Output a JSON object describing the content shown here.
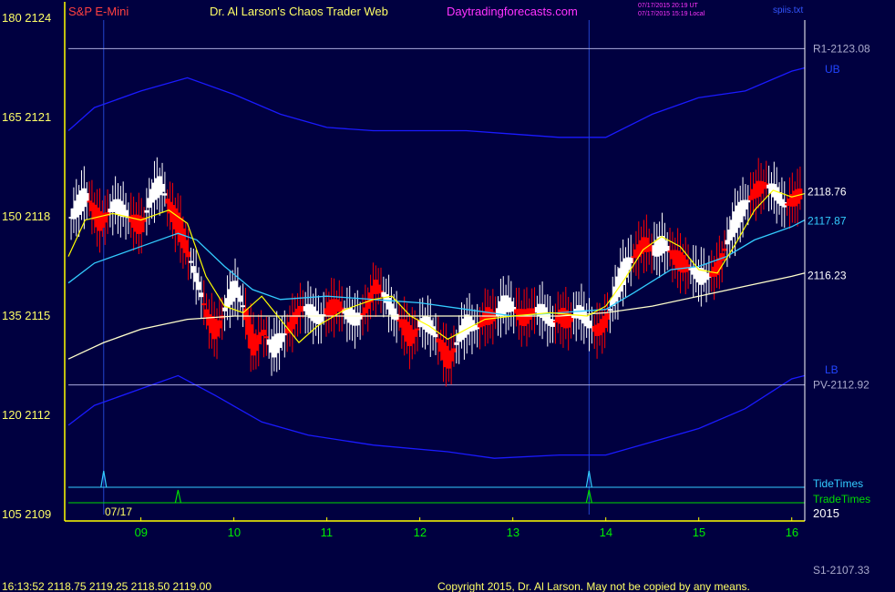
{
  "header": {
    "instrument": "S&P E-Mini",
    "site_title": "Dr. Al Larson's Chaos Trader Web",
    "site_url": "Daytradingforecasts.com",
    "timestamp_ut": "07/17/2015 20:19 UT",
    "timestamp_local": "07/17/2015 15:19 Local",
    "file": "spiis.txt"
  },
  "footer": {
    "quote_line": "16:13:52  2118.75  2119.25  2118.50  2119.00",
    "copyright": "Copyright 2015, Dr. Al Larson. May not be copied by any means.",
    "s1_label": "S1-2107.33"
  },
  "colors": {
    "background": "#000040",
    "axis": "#ffff00",
    "frame": "#ffff00",
    "up_bar": "#ffffff",
    "down_bar": "#ff0000",
    "band": "#1a1aff",
    "ema_fast": "#ffff00",
    "ema_mid": "#33ccff",
    "ema_slow": "#ffffcc",
    "tide": "#33ccff",
    "trade": "#00dd00",
    "instrument": "#ff4040",
    "site_title": "#ffff66",
    "site_url": "#ff33ff"
  },
  "chart_data": {
    "type": "candlestick",
    "y_ticks": [
      {
        "left": "180",
        "price": "2124",
        "value": 2124
      },
      {
        "left": "165",
        "price": "2121",
        "value": 2121
      },
      {
        "left": "150",
        "price": "2118",
        "value": 2118
      },
      {
        "left": "135",
        "price": "2115",
        "value": 2115
      },
      {
        "left": "120",
        "price": "2112",
        "value": 2112
      },
      {
        "left": "105",
        "price": "2109",
        "value": 2109
      }
    ],
    "ylim": [
      2109,
      2124
    ],
    "x_ticks": [
      "09",
      "10",
      "11",
      "12",
      "13",
      "14",
      "15",
      "16"
    ],
    "xlim": [
      8.22,
      16.14
    ],
    "date_label": "07/17",
    "year_label": "2015",
    "levels": [
      {
        "label": "R1-2123.08",
        "value": 2123.08
      },
      {
        "label": "PV-2112.92",
        "value": 2112.92
      }
    ],
    "band_labels": {
      "upper": "UB",
      "lower": "LB"
    },
    "ma_labels": [
      {
        "label": "2118.76",
        "value": 2118.76
      },
      {
        "label": "2117.87",
        "value": 2117.87
      },
      {
        "label": "2116.23",
        "value": 2116.23
      }
    ],
    "tide_label": "TideTimes",
    "trade_label": "TradeTimes",
    "tide_times": [
      8.6,
      13.82
    ],
    "trade_times": [
      9.4,
      13.82
    ],
    "vertical_markers": [
      8.6,
      13.82
    ],
    "upper_band": [
      [
        8.22,
        2120.6
      ],
      [
        8.5,
        2121.3
      ],
      [
        9.0,
        2121.8
      ],
      [
        9.5,
        2122.2
      ],
      [
        10.0,
        2121.7
      ],
      [
        10.5,
        2121.1
      ],
      [
        11.0,
        2120.7
      ],
      [
        11.5,
        2120.6
      ],
      [
        12.0,
        2120.6
      ],
      [
        12.5,
        2120.6
      ],
      [
        13.0,
        2120.5
      ],
      [
        13.5,
        2120.4
      ],
      [
        14.0,
        2120.4
      ],
      [
        14.5,
        2121.1
      ],
      [
        15.0,
        2121.6
      ],
      [
        15.5,
        2121.8
      ],
      [
        16.0,
        2122.4
      ],
      [
        16.14,
        2122.5
      ]
    ],
    "lower_band": [
      [
        8.22,
        2111.7
      ],
      [
        8.5,
        2112.3
      ],
      [
        9.0,
        2112.8
      ],
      [
        9.4,
        2113.2
      ],
      [
        9.8,
        2112.6
      ],
      [
        10.3,
        2111.8
      ],
      [
        10.8,
        2111.4
      ],
      [
        11.5,
        2111.1
      ],
      [
        12.3,
        2110.9
      ],
      [
        12.8,
        2110.7
      ],
      [
        13.5,
        2110.8
      ],
      [
        14.0,
        2110.8
      ],
      [
        14.5,
        2111.2
      ],
      [
        15.0,
        2111.6
      ],
      [
        15.5,
        2112.2
      ],
      [
        16.0,
        2113.1
      ],
      [
        16.14,
        2113.2
      ]
    ],
    "ema_fast": [
      [
        8.22,
        2116.8
      ],
      [
        8.4,
        2117.9
      ],
      [
        8.7,
        2118.1
      ],
      [
        9.0,
        2117.9
      ],
      [
        9.3,
        2118.2
      ],
      [
        9.5,
        2117.8
      ],
      [
        9.7,
        2116.2
      ],
      [
        9.9,
        2115.3
      ],
      [
        10.1,
        2115.1
      ],
      [
        10.3,
        2115.6
      ],
      [
        10.5,
        2114.9
      ],
      [
        10.7,
        2114.2
      ],
      [
        10.9,
        2114.7
      ],
      [
        11.2,
        2115.2
      ],
      [
        11.5,
        2115.5
      ],
      [
        11.7,
        2115.6
      ],
      [
        11.9,
        2115.0
      ],
      [
        12.1,
        2114.7
      ],
      [
        12.3,
        2114.3
      ],
      [
        12.5,
        2114.6
      ],
      [
        12.7,
        2114.9
      ],
      [
        13.0,
        2115.0
      ],
      [
        13.4,
        2115.1
      ],
      [
        13.8,
        2115.0
      ],
      [
        14.0,
        2115.3
      ],
      [
        14.2,
        2116.1
      ],
      [
        14.4,
        2117.0
      ],
      [
        14.6,
        2117.4
      ],
      [
        14.8,
        2117.1
      ],
      [
        15.0,
        2116.4
      ],
      [
        15.2,
        2116.3
      ],
      [
        15.4,
        2117.2
      ],
      [
        15.6,
        2118.2
      ],
      [
        15.8,
        2118.8
      ],
      [
        16.0,
        2118.6
      ],
      [
        16.14,
        2118.7
      ]
    ],
    "ema_mid": [
      [
        8.22,
        2116.0
      ],
      [
        8.5,
        2116.6
      ],
      [
        9.0,
        2117.1
      ],
      [
        9.4,
        2117.5
      ],
      [
        9.6,
        2117.3
      ],
      [
        9.9,
        2116.5
      ],
      [
        10.2,
        2115.8
      ],
      [
        10.5,
        2115.5
      ],
      [
        11.0,
        2115.6
      ],
      [
        11.5,
        2115.5
      ],
      [
        12.0,
        2115.4
      ],
      [
        12.5,
        2115.2
      ],
      [
        13.0,
        2115.0
      ],
      [
        13.5,
        2115.1
      ],
      [
        14.0,
        2115.2
      ],
      [
        14.3,
        2115.7
      ],
      [
        14.7,
        2116.4
      ],
      [
        15.0,
        2116.5
      ],
      [
        15.3,
        2116.8
      ],
      [
        15.6,
        2117.3
      ],
      [
        16.0,
        2117.7
      ],
      [
        16.14,
        2117.9
      ]
    ],
    "ema_slow": [
      [
        8.22,
        2113.7
      ],
      [
        8.6,
        2114.2
      ],
      [
        9.0,
        2114.6
      ],
      [
        9.5,
        2114.9
      ],
      [
        10.0,
        2115.0
      ],
      [
        10.5,
        2115.0
      ],
      [
        11.0,
        2115.0
      ],
      [
        11.5,
        2115.0
      ],
      [
        12.0,
        2115.0
      ],
      [
        12.5,
        2115.0
      ],
      [
        13.0,
        2115.0
      ],
      [
        13.5,
        2115.0
      ],
      [
        14.0,
        2115.1
      ],
      [
        14.5,
        2115.3
      ],
      [
        15.0,
        2115.6
      ],
      [
        15.5,
        2115.9
      ],
      [
        16.0,
        2116.2
      ],
      [
        16.14,
        2116.3
      ]
    ],
    "price_path": [
      [
        8.25,
        2118.0
      ],
      [
        8.4,
        2118.6
      ],
      [
        8.55,
        2117.9
      ],
      [
        8.7,
        2118.3
      ],
      [
        8.85,
        2118.0
      ],
      [
        9.0,
        2117.8
      ],
      [
        9.1,
        2118.6
      ],
      [
        9.2,
        2118.9
      ],
      [
        9.3,
        2118.3
      ],
      [
        9.4,
        2117.8
      ],
      [
        9.5,
        2116.8
      ],
      [
        9.6,
        2115.9
      ],
      [
        9.7,
        2115.0
      ],
      [
        9.8,
        2114.6
      ],
      [
        9.9,
        2115.3
      ],
      [
        10.0,
        2115.8
      ],
      [
        10.1,
        2115.2
      ],
      [
        10.2,
        2114.1
      ],
      [
        10.3,
        2114.6
      ],
      [
        10.4,
        2113.9
      ],
      [
        10.5,
        2114.3
      ],
      [
        10.6,
        2114.8
      ],
      [
        10.7,
        2115.3
      ],
      [
        10.8,
        2115.1
      ],
      [
        10.9,
        2114.8
      ],
      [
        11.0,
        2115.3
      ],
      [
        11.1,
        2115.4
      ],
      [
        11.2,
        2115.0
      ],
      [
        11.3,
        2114.8
      ],
      [
        11.4,
        2115.2
      ],
      [
        11.5,
        2116.0
      ],
      [
        11.6,
        2115.6
      ],
      [
        11.7,
        2115.0
      ],
      [
        11.8,
        2114.8
      ],
      [
        11.9,
        2114.4
      ],
      [
        12.0,
        2114.8
      ],
      [
        12.1,
        2114.6
      ],
      [
        12.2,
        2114.2
      ],
      [
        12.3,
        2113.7
      ],
      [
        12.4,
        2114.3
      ],
      [
        12.5,
        2114.7
      ],
      [
        12.6,
        2114.6
      ],
      [
        12.7,
        2115.1
      ],
      [
        12.8,
        2115.0
      ],
      [
        12.9,
        2115.3
      ],
      [
        13.0,
        2115.2
      ],
      [
        13.1,
        2115.0
      ],
      [
        13.2,
        2115.2
      ],
      [
        13.3,
        2115.1
      ],
      [
        13.4,
        2114.7
      ],
      [
        13.5,
        2115.1
      ],
      [
        13.6,
        2114.9
      ],
      [
        13.7,
        2115.1
      ],
      [
        13.8,
        2114.7
      ],
      [
        13.9,
        2114.6
      ],
      [
        14.0,
        2115.0
      ],
      [
        14.1,
        2115.7
      ],
      [
        14.2,
        2116.4
      ],
      [
        14.3,
        2116.9
      ],
      [
        14.4,
        2117.3
      ],
      [
        14.5,
        2116.9
      ],
      [
        14.6,
        2117.1
      ],
      [
        14.7,
        2116.9
      ],
      [
        14.8,
        2116.7
      ],
      [
        14.9,
        2116.4
      ],
      [
        15.0,
        2116.1
      ],
      [
        15.1,
        2116.2
      ],
      [
        15.2,
        2116.6
      ],
      [
        15.3,
        2117.3
      ],
      [
        15.4,
        2117.9
      ],
      [
        15.5,
        2118.4
      ],
      [
        15.6,
        2118.9
      ],
      [
        15.7,
        2119.0
      ],
      [
        15.8,
        2118.7
      ],
      [
        15.9,
        2118.3
      ],
      [
        16.0,
        2118.6
      ],
      [
        16.1,
        2118.8
      ]
    ]
  }
}
